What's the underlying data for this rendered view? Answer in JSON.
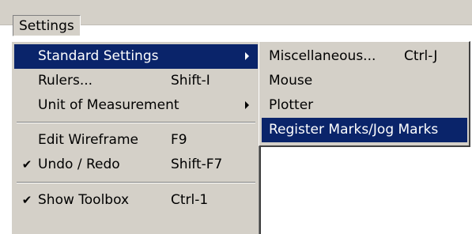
{
  "menubar": {
    "settings_label": "Settings"
  },
  "menu": {
    "items": [
      {
        "label": "Standard Settings",
        "shortcut": "",
        "checked": false,
        "submenu": true,
        "highlighted": true
      },
      {
        "label": "Rulers...",
        "shortcut": "Shift-I",
        "checked": false,
        "submenu": false,
        "highlighted": false
      },
      {
        "label": "Unit of Measurement",
        "shortcut": "",
        "checked": false,
        "submenu": true,
        "highlighted": false
      },
      {
        "label": "Edit Wireframe",
        "shortcut": "F9",
        "checked": false,
        "submenu": false,
        "highlighted": false
      },
      {
        "label": "Undo / Redo",
        "shortcut": "Shift-F7",
        "checked": true,
        "submenu": false,
        "highlighted": false
      },
      {
        "label": "Show Toolbox",
        "shortcut": "Ctrl-1",
        "checked": true,
        "submenu": false,
        "highlighted": false
      }
    ],
    "check_glyph": "✔"
  },
  "submenu": {
    "items": [
      {
        "label": "Miscellaneous...",
        "shortcut": "Ctrl-J",
        "highlighted": false
      },
      {
        "label": "Mouse",
        "shortcut": "",
        "highlighted": false
      },
      {
        "label": "Plotter",
        "shortcut": "",
        "highlighted": false
      },
      {
        "label": "Register Marks/Jog Marks",
        "shortcut": "",
        "highlighted": true
      }
    ]
  },
  "colors": {
    "menu_face": "#d4d0c8",
    "highlight": "#0a246a",
    "highlight_text": "#ffffff"
  },
  "icons": {
    "check": "check-icon",
    "submenu_arrow": "submenu-arrow-icon"
  }
}
